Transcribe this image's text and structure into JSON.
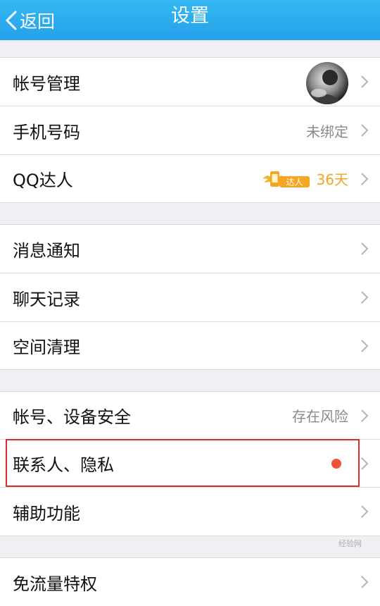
{
  "header": {
    "back_label": "返回",
    "title": "设置",
    "background": "#2aa8ee"
  },
  "groups": [
    {
      "items": [
        {
          "label": "帐号管理",
          "value_type": "avatar",
          "value_icon": "user-avatar"
        },
        {
          "label": "手机号码",
          "value": "未绑定"
        },
        {
          "label": "QQ达人",
          "badge_text": "达人",
          "badge_days": "36天",
          "badge_icon": "winged-phone-icon"
        }
      ]
    },
    {
      "items": [
        {
          "label": "消息通知"
        },
        {
          "label": "聊天记录"
        },
        {
          "label": "空间清理"
        }
      ]
    },
    {
      "items": [
        {
          "label": "帐号、设备安全",
          "value": "存在风险"
        },
        {
          "label": "联系人、隐私",
          "indicator": "red-dot",
          "highlighted": true
        },
        {
          "label": "辅助功能"
        }
      ]
    },
    {
      "items": [
        {
          "label": "免流量特权"
        }
      ]
    }
  ],
  "colors": {
    "accent": "#2aa8ee",
    "highlight_border": "#e02b2b",
    "badge": "#f5a623",
    "dot": "#f0513b"
  },
  "watermark": "经验网"
}
